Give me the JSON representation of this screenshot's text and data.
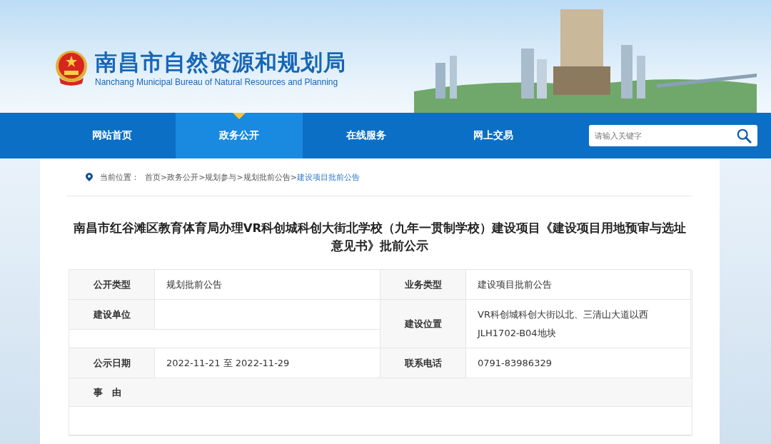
{
  "header": {
    "title": "南昌市自然资源和规划局",
    "subtitle": "Nanchang Municipal Bureau of Natural Resources and Planning"
  },
  "nav": {
    "items": [
      {
        "label": "网站首页",
        "selected": false
      },
      {
        "label": "政务公开",
        "selected": true
      },
      {
        "label": "在线服务",
        "selected": false
      },
      {
        "label": "网上交易",
        "selected": false
      }
    ],
    "search": {
      "placeholder": "请输入关键字"
    }
  },
  "breadcrumb": {
    "label": "当前位置：",
    "separator": ">",
    "items": [
      {
        "label": "首页",
        "selected": false
      },
      {
        "label": "政务公开",
        "selected": false
      },
      {
        "label": "规划参与",
        "selected": false
      },
      {
        "label": "规划批前公告",
        "selected": false
      },
      {
        "label": "建设项目批前公告",
        "selected": true
      }
    ]
  },
  "article": {
    "title": "南昌市红谷滩区教育体育局办理VR科创城科创大街北学校（九年一贯制学校）建设项目《建设项目用地预审与选址意见书》批前公示"
  },
  "info": {
    "items": [
      {
        "label": "公开类型",
        "lines": [
          "规划批前公告"
        ]
      },
      {
        "label": "业务类型",
        "lines": [
          "建设项目批前公告"
        ]
      },
      {
        "label": "建设单位"
      },
      {
        "label": "建设位置",
        "lines": [
          "VR科创城科创大街以北、三清山大道以西",
          "JLH1702-B04地块"
        ]
      },
      {
        "label": "公示日期",
        "lines": [
          "2022-11-21 至 2022-11-29"
        ]
      },
      {
        "label": "联系电话",
        "lines": [
          "0791-83986329"
        ]
      }
    ],
    "reason": {
      "label": "事　由"
    }
  }
}
